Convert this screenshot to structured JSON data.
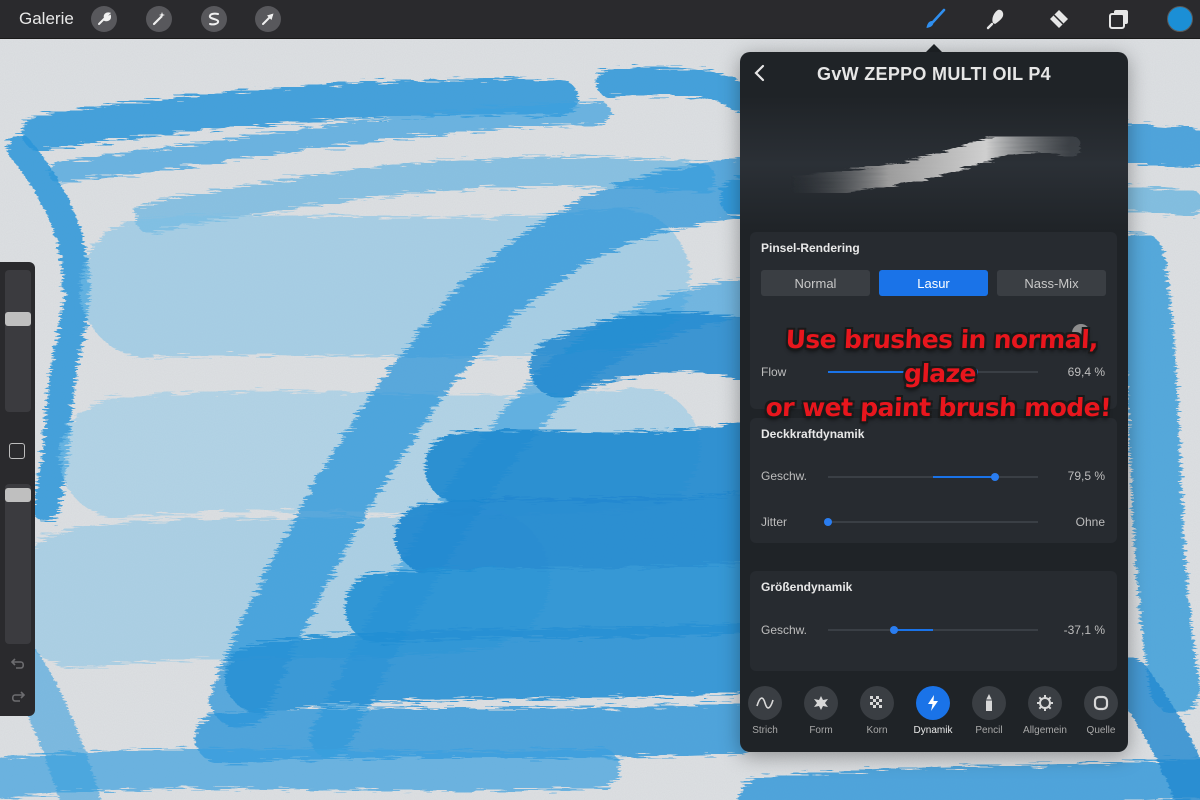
{
  "topbar": {
    "gallery_label": "Galerie",
    "left_tools": [
      {
        "name": "wrench-icon"
      },
      {
        "name": "magic-wand-icon"
      },
      {
        "name": "selection-icon"
      },
      {
        "name": "transform-arrow-icon"
      }
    ],
    "right_tools": [
      {
        "name": "brush-icon",
        "active": true
      },
      {
        "name": "smudge-icon"
      },
      {
        "name": "eraser-icon"
      },
      {
        "name": "layers-icon"
      }
    ],
    "current_color": "#1b8fd6"
  },
  "sidebar": {
    "size_slider_level": 0.35,
    "opacity_slider_level": 0.02,
    "icons": [
      "undo-icon",
      "redo-icon"
    ]
  },
  "panel": {
    "title": "GvW ZEPPO MULTI OIL P4",
    "rendering": {
      "title": "Pinsel-Rendering",
      "modes": [
        "Normal",
        "Lasur",
        "Nass-Mix"
      ],
      "selected": "Lasur",
      "flow_label": "Flow",
      "flow_value": "69,4 %",
      "flow_fraction": 0.694
    },
    "opacity_dynamics": {
      "title": "Deckkraftdynamik",
      "speed_label": "Geschw.",
      "speed_value": "79,5 %",
      "speed_fraction": 0.795,
      "jitter_label": "Jitter",
      "jitter_value": "Ohne",
      "jitter_fraction": 0
    },
    "size_dynamics": {
      "title": "Größendynamik",
      "speed_label": "Geschw.",
      "speed_value": "-37,1 %",
      "speed_fraction": -0.371
    },
    "tabs": [
      {
        "label": "Strich",
        "icon": "stroke-path-icon"
      },
      {
        "label": "Form",
        "icon": "shape-icon"
      },
      {
        "label": "Korn",
        "icon": "grain-icon"
      },
      {
        "label": "Dynamik",
        "icon": "dynamics-bolt-icon",
        "active": true
      },
      {
        "label": "Pencil",
        "icon": "pencil-icon"
      },
      {
        "label": "Allgemein",
        "icon": "general-gear-icon"
      },
      {
        "label": "Quelle",
        "icon": "source-icon"
      }
    ]
  },
  "overlay": {
    "line1": "Use brushes in normal, glaze",
    "line2": "or wet paint brush mode!"
  },
  "colors": {
    "paint": "#1e90d6",
    "accent": "#1a73e8",
    "annotation": "#e8161d"
  }
}
